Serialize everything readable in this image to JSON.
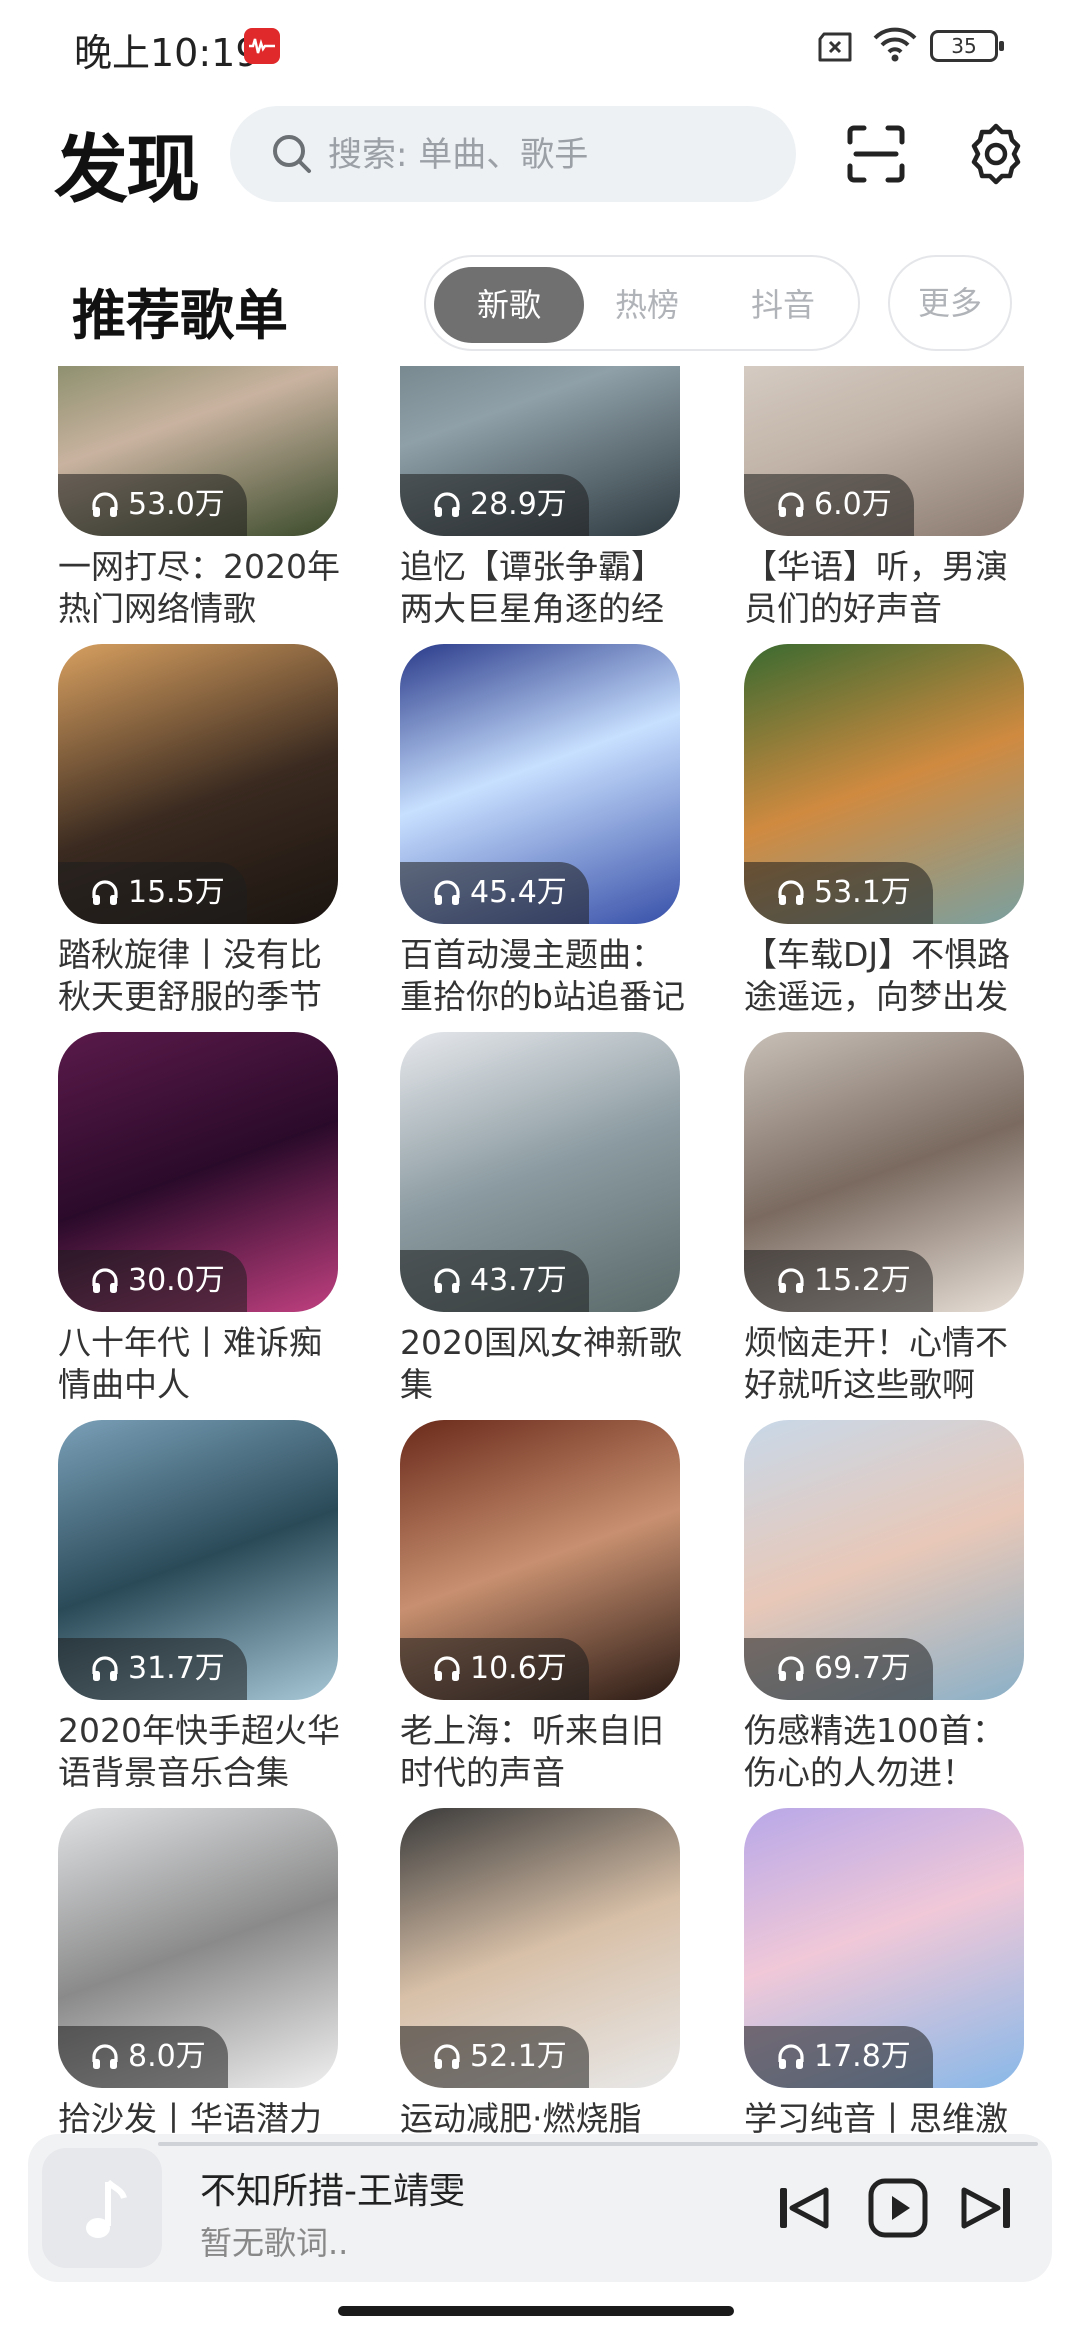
{
  "status_bar": {
    "time": "晚上10:19",
    "battery": "35"
  },
  "header": {
    "title": "发现",
    "search_placeholder": "搜索: 单曲、歌手"
  },
  "section": {
    "title": "推荐歌单",
    "tabs": [
      "新歌",
      "热榜",
      "抖音"
    ],
    "active_tab": "新歌",
    "more": "更多"
  },
  "playlists": [
    {
      "plays": "53.0万",
      "name": "一网打尽：2020年热门网络情歌"
    },
    {
      "plays": "28.9万",
      "name": "追忆【谭张争霸】两大巨星角逐的经"
    },
    {
      "plays": "6.0万",
      "name": "【华语】听，男演员们的好声音"
    },
    {
      "plays": "15.5万",
      "name": "踏秋旋律丨没有比秋天更舒服的季节"
    },
    {
      "plays": "45.4万",
      "name": "百首动漫主题曲：重拾你的b站追番记"
    },
    {
      "plays": "53.1万",
      "name": "【车载DJ】不惧路途遥远，向梦出发"
    },
    {
      "plays": "30.0万",
      "name": "八十年代丨难诉痴情曲中人"
    },
    {
      "plays": "43.7万",
      "name": "2020国风女神新歌集"
    },
    {
      "plays": "15.2万",
      "name": "烦恼走开！心情不好就听这些歌啊"
    },
    {
      "plays": "31.7万",
      "name": "2020年快手超火华语背景音乐合集"
    },
    {
      "plays": "10.6万",
      "name": "老上海：听来自旧时代的声音"
    },
    {
      "plays": "69.7万",
      "name": "伤感精选100首：伤心的人勿进！"
    },
    {
      "plays": "8.0万",
      "name": "拾沙发丨华语潜力"
    },
    {
      "plays": "52.1万",
      "name": "运动减肥·燃烧脂"
    },
    {
      "plays": "17.8万",
      "name": "学习纯音丨思维激"
    }
  ],
  "player": {
    "song": "不知所措-王靖雯",
    "lyric": "暂无歌词.."
  }
}
